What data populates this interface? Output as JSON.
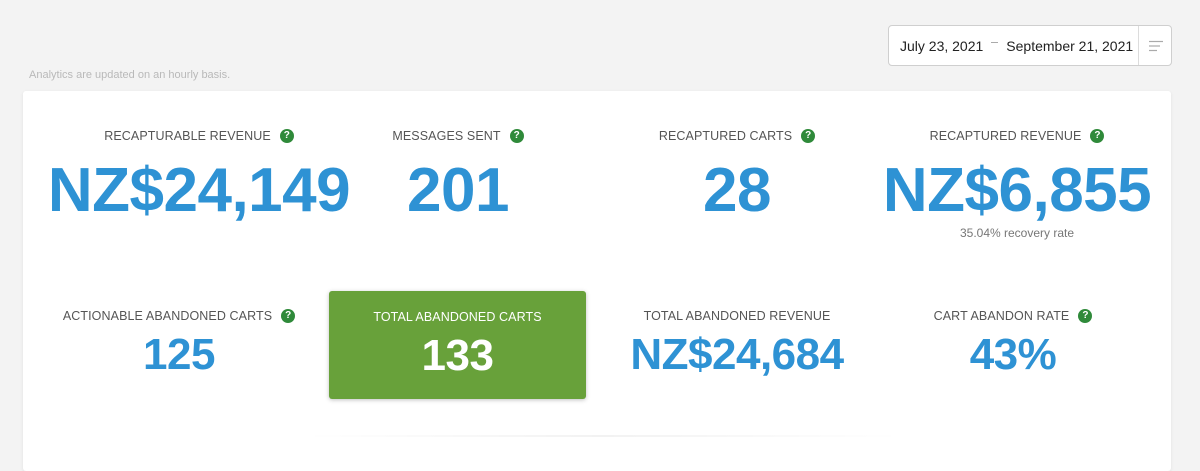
{
  "date_range": {
    "start": "July 23, 2021",
    "end": "September 21, 2021"
  },
  "note": "Analytics are updated on an hourly basis.",
  "metrics": {
    "recapturable_revenue": {
      "label": "RECAPTURABLE REVENUE",
      "value": "NZ$24,149"
    },
    "messages_sent": {
      "label": "MESSAGES SENT",
      "value": "201"
    },
    "recaptured_carts": {
      "label": "RECAPTURED CARTS",
      "value": "28"
    },
    "recaptured_revenue": {
      "label": "RECAPTURED REVENUE",
      "value": "NZ$6,855",
      "sub": "35.04% recovery rate"
    },
    "actionable_abandoned_carts": {
      "label": "ACTIONABLE ABANDONED CARTS",
      "value": "125"
    },
    "total_abandoned_carts": {
      "label": "TOTAL ABANDONED CARTS",
      "value": "133"
    },
    "total_abandoned_revenue": {
      "label": "TOTAL ABANDONED REVENUE",
      "value": "NZ$24,684"
    },
    "cart_abandon_rate": {
      "label": "CART ABANDON RATE",
      "value": "43%"
    }
  },
  "help_glyph": "?",
  "colors": {
    "value_blue": "#2e92d4",
    "highlight_green": "#68a13a",
    "help_green": "#2f8a3a",
    "background": "#f3f3f3"
  },
  "icons": {
    "filter": "filter-lines-icon",
    "help": "question-circle-icon"
  }
}
